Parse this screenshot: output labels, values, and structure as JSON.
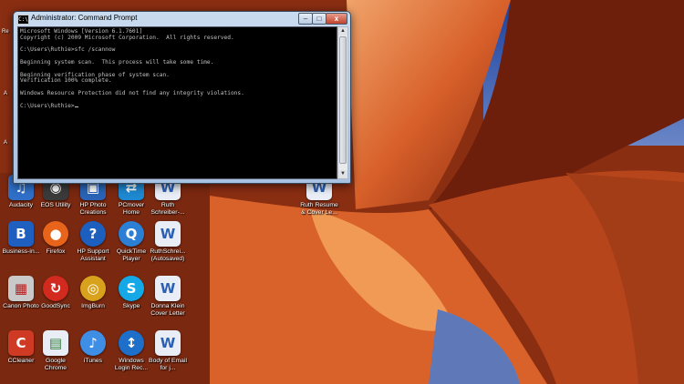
{
  "window": {
    "title": "Administrator: Command Prompt",
    "icon_label": "C:\\",
    "min_glyph": "–",
    "max_glyph": "□",
    "close_glyph": "x",
    "console_lines": [
      "Microsoft Windows [Version 6.1.7601]",
      "Copyright (c) 2009 Microsoft Corporation.  All rights reserved.",
      "",
      "C:\\Users\\Ruthie>sfc /scannow",
      "",
      "Beginning system scan.  This process will take some time.",
      "",
      "Beginning verification phase of system scan.",
      "Verification 100% complete.",
      "",
      "Windows Resource Protection did not find any integrity violations.",
      "",
      "C:\\Users\\Ruthie>"
    ]
  },
  "peek": {
    "top": "Re",
    "mid": "A",
    "low": "A"
  },
  "desktop_icons": [
    {
      "name": "audacity",
      "label": "Audacity",
      "icon": "audacity-icon",
      "color": "#2f6fc7",
      "glyph": "♫"
    },
    {
      "name": "eos-utility",
      "label": "EOS Utility",
      "icon": "camera-icon",
      "color": "#3a3a3a",
      "glyph": "◉"
    },
    {
      "name": "hp-photo-creations",
      "label": "HP Photo Creations",
      "icon": "photo-icon",
      "color": "#2a63b5",
      "glyph": "▣"
    },
    {
      "name": "pcmover-home",
      "label": "PCmover Home",
      "icon": "pcmover-icon",
      "color": "#1e88d0",
      "glyph": "⇄"
    },
    {
      "name": "ruth-schreiber",
      "label": "Ruth Schreiber-...",
      "icon": "document-icon",
      "color": "#e9eef6",
      "glyph": "W"
    },
    {
      "name": "ruth-resume",
      "label": "Ruth Resume & Cover Le...",
      "icon": "document-icon",
      "color": "#e9eef6",
      "glyph": "W"
    },
    {
      "name": "business-in",
      "label": "Business-in...",
      "icon": "briefcase-icon",
      "color": "#1f5fc0",
      "glyph": "B"
    },
    {
      "name": "firefox",
      "label": "Firefox",
      "icon": "firefox-icon",
      "color": "#e8641b",
      "glyph": "●"
    },
    {
      "name": "hp-support-assistant",
      "label": "HP Support Assistant",
      "icon": "question-icon",
      "color": "#1d5fbf",
      "glyph": "?"
    },
    {
      "name": "quicktime-player",
      "label": "QuickTime Player",
      "icon": "quicktime-icon",
      "color": "#2b7fd4",
      "glyph": "Q"
    },
    {
      "name": "ruth-schreiber-autosaved",
      "label": "RuthSchrei... (Autosaved)",
      "icon": "document-icon",
      "color": "#e9eef6",
      "glyph": "W"
    },
    {
      "name": "canon-photo",
      "label": "Canon Photo",
      "icon": "canon-icon",
      "color": "#c9c9c9",
      "glyph": "▦"
    },
    {
      "name": "goodsync",
      "label": "GoodSync",
      "icon": "sync-icon",
      "color": "#d22a1e",
      "glyph": "↻"
    },
    {
      "name": "imgburn",
      "label": "ImgBurn",
      "icon": "disc-icon",
      "color": "#d9a21d",
      "glyph": "◎"
    },
    {
      "name": "skype",
      "label": "Skype",
      "icon": "skype-icon",
      "color": "#15a8e6",
      "glyph": "S"
    },
    {
      "name": "donna-klein",
      "label": "Donna Klein Cover Letter",
      "icon": "document-icon",
      "color": "#e9eef6",
      "glyph": "W"
    },
    {
      "name": "ccleaner",
      "label": "CCleaner",
      "icon": "ccleaner-icon",
      "color": "#cf3a24",
      "glyph": "C"
    },
    {
      "name": "google-chrome",
      "label": "Google Chrome",
      "icon": "chrome-icon",
      "color": "#e9eef6",
      "glyph": "▤"
    },
    {
      "name": "itunes",
      "label": "iTunes",
      "icon": "itunes-icon",
      "color": "#3f8ee6",
      "glyph": "♪"
    },
    {
      "name": "windows-login-rec",
      "label": "Windows Login Rec...",
      "icon": "thermometer-icon",
      "color": "#1d6fc9",
      "glyph": "↕"
    },
    {
      "name": "body-of-email",
      "label": "Body of Email for j...",
      "icon": "document-icon",
      "color": "#e9eef6",
      "glyph": "W"
    }
  ]
}
